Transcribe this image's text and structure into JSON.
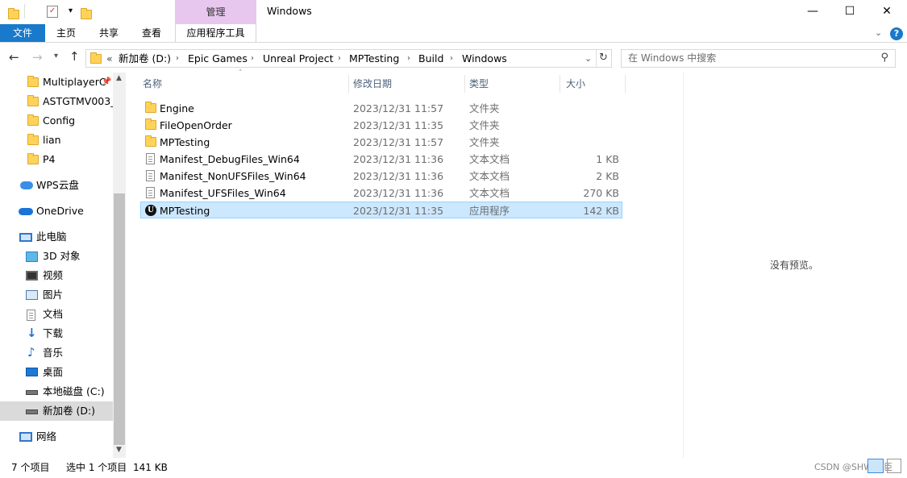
{
  "window": {
    "title": "Windows",
    "context_tab": "管理",
    "min": "—",
    "max": "☐",
    "close": "✕"
  },
  "ribbon": {
    "tabs": [
      "文件",
      "主页",
      "共享",
      "查看",
      "应用程序工具"
    ]
  },
  "address": {
    "overflow": "«",
    "crumbs": [
      "新加卷 (D:)",
      "Epic Games",
      "Unreal Project",
      "MPTesting",
      "Build",
      "Windows"
    ],
    "search_placeholder": "在 Windows 中搜索"
  },
  "nav": {
    "quick": [
      "MultiplayerC",
      "ASTGTMV003_",
      "Config",
      "lian",
      "P4"
    ],
    "wps": "WPS云盘",
    "onedrive": "OneDrive",
    "thispc": "此电脑",
    "pc_items": [
      "3D 对象",
      "视频",
      "图片",
      "文档",
      "下载",
      "音乐",
      "桌面",
      "本地磁盘 (C:)",
      "新加卷 (D:)"
    ],
    "network": "网络"
  },
  "columns": {
    "name": "名称",
    "date": "修改日期",
    "type": "类型",
    "size": "大小"
  },
  "files": [
    {
      "name": "Engine",
      "date": "2023/12/31 11:57",
      "type": "文件夹",
      "size": "",
      "icon": "folder"
    },
    {
      "name": "FileOpenOrder",
      "date": "2023/12/31 11:35",
      "type": "文件夹",
      "size": "",
      "icon": "folder"
    },
    {
      "name": "MPTesting",
      "date": "2023/12/31 11:57",
      "type": "文件夹",
      "size": "",
      "icon": "folder"
    },
    {
      "name": "Manifest_DebugFiles_Win64",
      "date": "2023/12/31 11:36",
      "type": "文本文档",
      "size": "1 KB",
      "icon": "document"
    },
    {
      "name": "Manifest_NonUFSFiles_Win64",
      "date": "2023/12/31 11:36",
      "type": "文本文档",
      "size": "2 KB",
      "icon": "document"
    },
    {
      "name": "Manifest_UFSFiles_Win64",
      "date": "2023/12/31 11:36",
      "type": "文本文档",
      "size": "270 KB",
      "icon": "document"
    },
    {
      "name": "MPTesting",
      "date": "2023/12/31 11:35",
      "type": "应用程序",
      "size": "142 KB",
      "icon": "unreal-app",
      "selected": true
    }
  ],
  "preview": {
    "text": "没有预览。"
  },
  "status": {
    "count": "7 个项目",
    "selection": "选中 1 个项目",
    "size": "141 KB",
    "watermark": "CSDN @SHWJ巨臣"
  },
  "colors": {
    "accent": "#1979ca",
    "context_tab": "#e8c7ef",
    "selection": "#cce8ff"
  }
}
